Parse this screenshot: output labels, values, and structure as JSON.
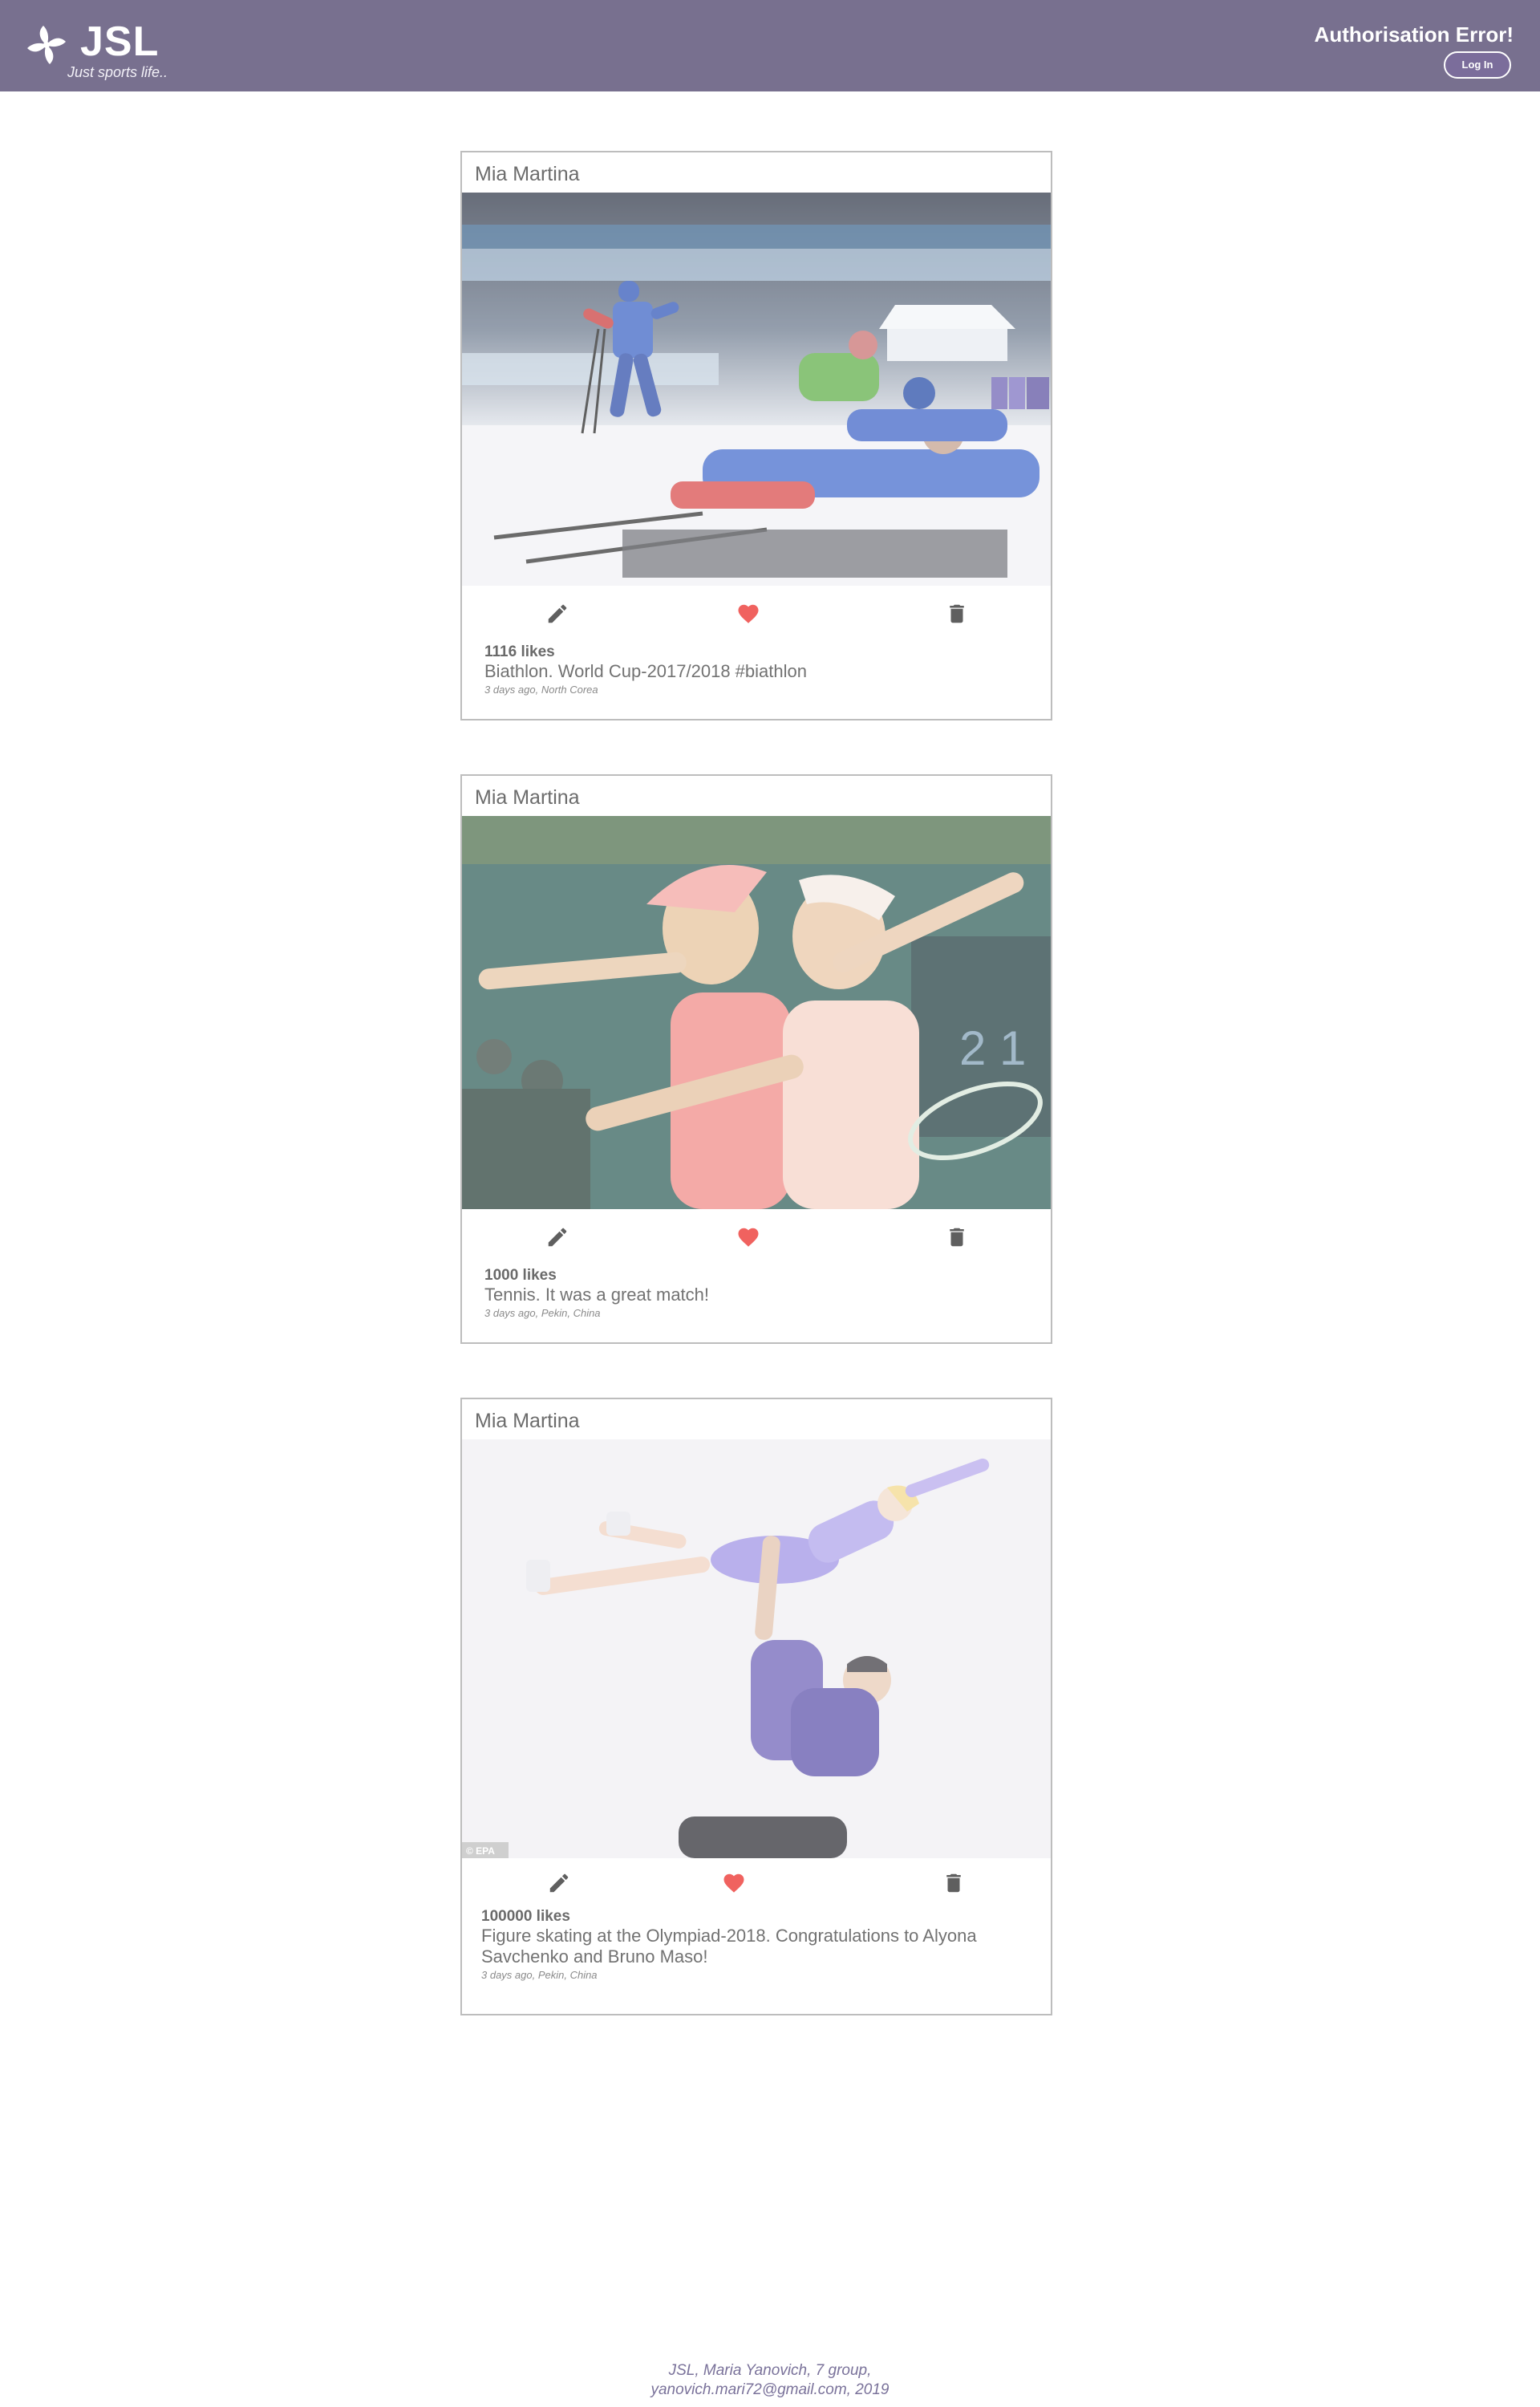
{
  "header": {
    "logo_text": "JSL",
    "tagline": "Just sports life..",
    "auth_error": "Authorisation Error!",
    "login_label": "Log In"
  },
  "colors": {
    "header_bg": "#78708f",
    "heart": "#f0625f",
    "icon": "#5f5f5f",
    "footer_text": "#7a729a"
  },
  "posts": [
    {
      "author": "Mia Martina",
      "photo": "biathlon skiers photo",
      "likes": "1116 likes",
      "caption": "Biathlon. World Cup-2017/2018 #biathlon",
      "meta": "3 days ago, North Corea",
      "icons": [
        "pencil-icon",
        "heart-icon",
        "trash-icon"
      ]
    },
    {
      "author": "Mia Martina",
      "photo": "tennis players hugging photo",
      "likes": "1000 likes",
      "caption": "Tennis. It was a great match!",
      "meta": "3 days ago, Pekin, China",
      "icons": [
        "pencil-icon",
        "heart-icon",
        "trash-icon"
      ]
    },
    {
      "author": "Mia Martina",
      "photo": "figure skating pair photo",
      "photo_credit": "© EPA",
      "likes": "100000 likes",
      "caption": "Figure skating at the Olympiad-2018. Congratulations to Alyona Savchenko and Bruno Maso!",
      "meta": "3 days ago, Pekin, China",
      "icons": [
        "pencil-icon",
        "heart-icon",
        "trash-icon"
      ]
    }
  ],
  "footer": {
    "line1": "JSL, Maria Yanovich, 7 group,",
    "line2": "yanovich.mari72@gmail.com, 2019"
  }
}
